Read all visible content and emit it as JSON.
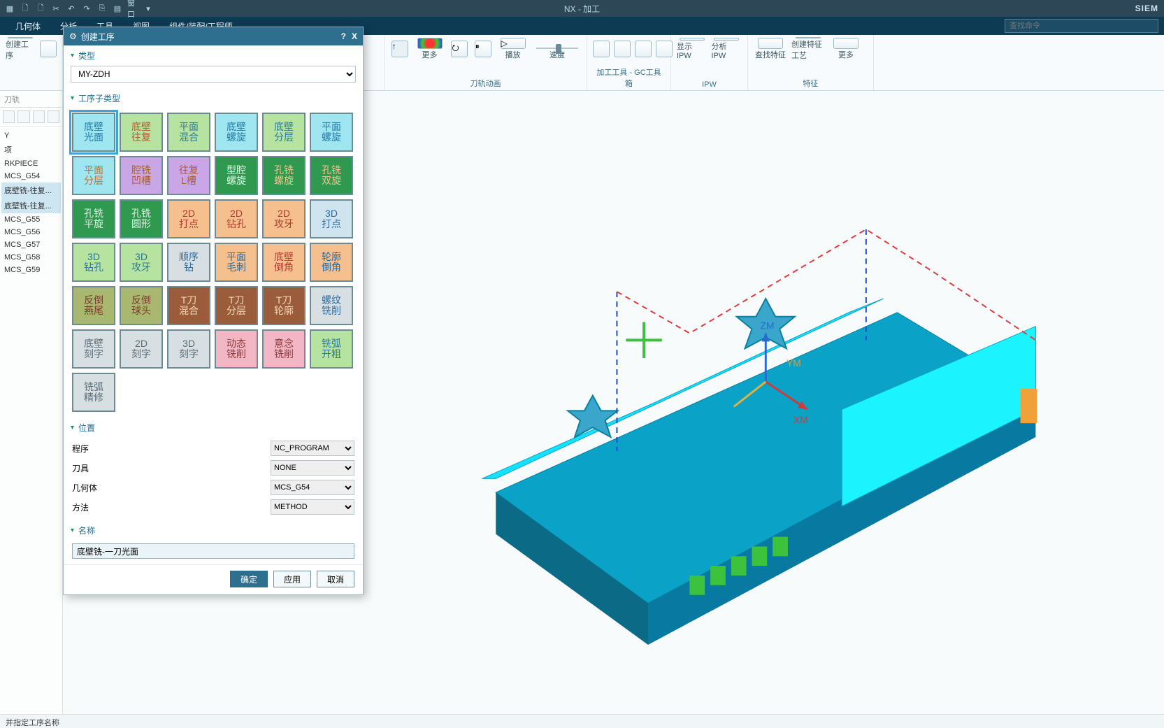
{
  "titlebar": {
    "center": "NX - 加工",
    "brand": "SIEM",
    "window_menu": "窗口"
  },
  "menubar": {
    "items": [
      "几何体",
      "分析",
      "工具",
      "视图",
      "组件/装配/工程师"
    ],
    "search_placeholder": "查找命令"
  },
  "ribbon": {
    "groups": [
      {
        "name": "",
        "labels": [
          "创建工序"
        ]
      },
      {
        "name": "刀轨动画",
        "labels": [
          "更多",
          "播放",
          "速度"
        ]
      },
      {
        "name": "加工工具 - GC工具箱",
        "labels": []
      },
      {
        "name": "IPW",
        "labels": [
          "显示 IPW",
          "分析 IPW"
        ]
      },
      {
        "name": "特征",
        "labels": [
          "查找特征",
          "创建特征工艺",
          "更多"
        ]
      }
    ]
  },
  "left_panel": {
    "header": "刀轨",
    "tree": [
      "Y",
      "项",
      "RKPIECE",
      "MCS_G54",
      "  底壁铣-往复...",
      "  底壁铣-往复...",
      "MCS_G55",
      "MCS_G56",
      "MCS_G57",
      "MCS_G58",
      "MCS_G59"
    ],
    "selected_indices": [
      4,
      5
    ]
  },
  "dialog": {
    "title": "创建工序",
    "help": "?",
    "close": "X",
    "sections": {
      "type": "类型",
      "subtype": "工序子类型",
      "location": "位置",
      "name": "名称"
    },
    "type_value": "MY-ZDH",
    "subtype_cells": [
      {
        "t": "底壁\n光面",
        "cls": "c-cyan",
        "sel": true
      },
      {
        "t": "底壁\n往复",
        "cls": "c-ltgreen2"
      },
      {
        "t": "平面\n混合",
        "cls": "c-ltgreen"
      },
      {
        "t": "底壁\n螺旋",
        "cls": "c-cyan"
      },
      {
        "t": "底壁\n分层",
        "cls": "c-ltgreen"
      },
      {
        "t": "平面\n螺旋",
        "cls": "c-cyan"
      },
      {
        "t": "平面\n分层",
        "cls": "c-cyan-or"
      },
      {
        "t": "腔铣\n凹槽",
        "cls": "c-purple"
      },
      {
        "t": "往复\nL槽",
        "cls": "c-purple"
      },
      {
        "t": "型腔\n螺旋",
        "cls": "c-green"
      },
      {
        "t": "孔铣\n螺旋",
        "cls": "c-green-or"
      },
      {
        "t": "孔铣\n双旋",
        "cls": "c-green-or"
      },
      {
        "t": "孔铣\n平旋",
        "cls": "c-green"
      },
      {
        "t": "孔铣\n圆形",
        "cls": "c-green"
      },
      {
        "t": "2D\n打点",
        "cls": "c-orange"
      },
      {
        "t": "2D\n钻孔",
        "cls": "c-orange"
      },
      {
        "t": "2D\n攻牙",
        "cls": "c-orange"
      },
      {
        "t": "3D\n打点",
        "cls": "c-pastelblue"
      },
      {
        "t": "3D\n钻孔",
        "cls": "c-ltgreen"
      },
      {
        "t": "3D\n攻牙",
        "cls": "c-ltgreen"
      },
      {
        "t": "顺序\n钻",
        "cls": "c-grey-bl"
      },
      {
        "t": "平面\n毛刺",
        "cls": "c-orange-bl"
      },
      {
        "t": "底壁\n倒角",
        "cls": "c-orange"
      },
      {
        "t": "轮廓\n倒角",
        "cls": "c-orange-bl"
      },
      {
        "t": "反倒\n燕尾",
        "cls": "c-olive"
      },
      {
        "t": "反倒\n球头",
        "cls": "c-olive"
      },
      {
        "t": "T刀\n混合",
        "cls": "c-dkred"
      },
      {
        "t": "T刀\n分层",
        "cls": "c-dkred"
      },
      {
        "t": "T刀\n轮廓",
        "cls": "c-dkred"
      },
      {
        "t": "螺纹\n铣削",
        "cls": "c-grey-bl"
      },
      {
        "t": "底壁\n刻字",
        "cls": "c-grey"
      },
      {
        "t": "2D\n刻字",
        "cls": "c-grey"
      },
      {
        "t": "3D\n刻字",
        "cls": "c-grey"
      },
      {
        "t": "动态\n铣削",
        "cls": "c-pink"
      },
      {
        "t": "意念\n铣削",
        "cls": "c-pink"
      },
      {
        "t": "铣弧\n开粗",
        "cls": "c-ltgreen"
      },
      {
        "t": "铣弧\n精修",
        "cls": "c-grey"
      }
    ],
    "loc": {
      "program_label": "程序",
      "program_value": "NC_PROGRAM",
      "tool_label": "刀具",
      "tool_value": "NONE",
      "geometry_label": "几何体",
      "geometry_value": "MCS_G54",
      "method_label": "方法",
      "method_value": "METHOD"
    },
    "name_value": "底壁铣-一刀光面",
    "buttons": {
      "ok": "确定",
      "apply": "应用",
      "cancel": "取消"
    }
  },
  "statusbar": {
    "text": "并指定工序名称"
  },
  "viewport": {
    "axis_labels": {
      "z": "ZM",
      "y": "YM",
      "x": "XM"
    }
  }
}
